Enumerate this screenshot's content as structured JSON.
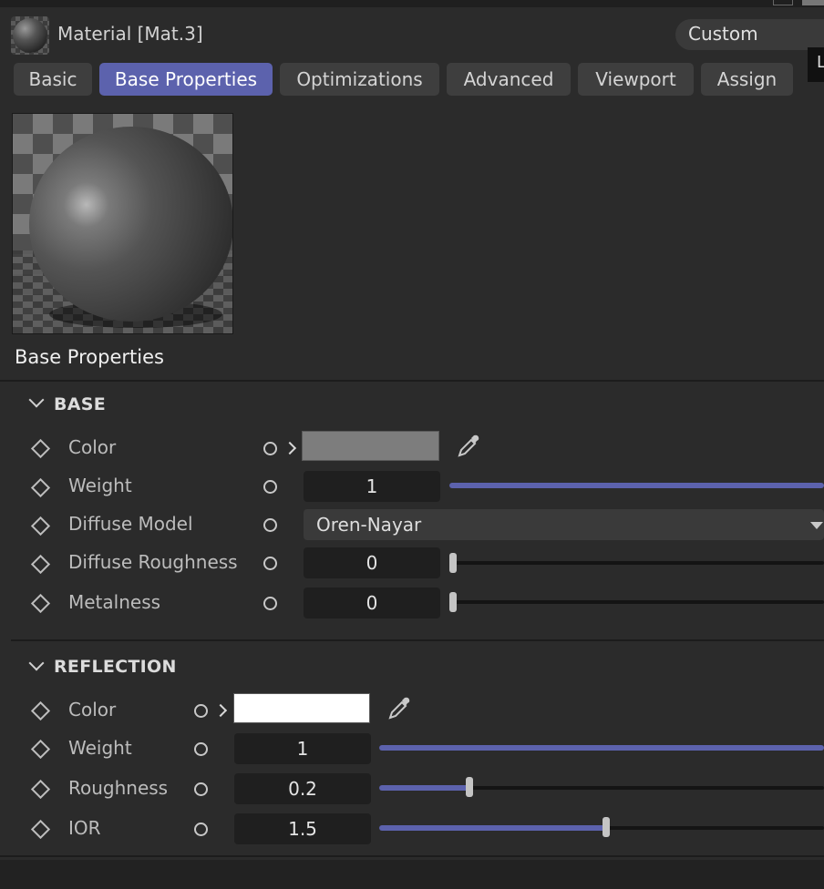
{
  "header": {
    "material_title": "Material [Mat.3]",
    "preset": "Custom",
    "side_flag": "L"
  },
  "tabs": [
    {
      "label": "Basic",
      "active": false
    },
    {
      "label": "Base Properties",
      "active": true
    },
    {
      "label": "Optimizations",
      "active": false
    },
    {
      "label": "Advanced",
      "active": false
    },
    {
      "label": "Viewport",
      "active": false
    },
    {
      "label": "Assign",
      "active": false
    }
  ],
  "section_title": "Base Properties",
  "base": {
    "header": "BASE",
    "color": {
      "label": "Color",
      "value": "#7d7d7d"
    },
    "weight": {
      "label": "Weight",
      "value": "1",
      "fraction": 1.0
    },
    "diffuse_model": {
      "label": "Diffuse Model",
      "value": "Oren-Nayar"
    },
    "diffuse_roughness": {
      "label": "Diffuse Roughness",
      "value": "0",
      "fraction": 0.0
    },
    "metalness": {
      "label": "Metalness",
      "value": "0",
      "fraction": 0.0
    }
  },
  "reflection": {
    "header": "REFLECTION",
    "color": {
      "label": "Color",
      "value": "#ffffff"
    },
    "weight": {
      "label": "Weight",
      "value": "1",
      "fraction": 1.0
    },
    "roughness": {
      "label": "Roughness",
      "value": "0.2",
      "fraction": 0.2
    },
    "ior": {
      "label": "IOR",
      "value": "1.5",
      "fraction": 0.5
    }
  },
  "colors": {
    "accent": "#5c62ad",
    "background": "#2b2b2b",
    "field": "#1f1f1f"
  },
  "icons": [
    "material-sphere-icon",
    "eyedropper-icon",
    "chevron-down-icon",
    "keyframe-diamond-icon",
    "animate-circle-icon",
    "dropdown-arrow-icon"
  ]
}
